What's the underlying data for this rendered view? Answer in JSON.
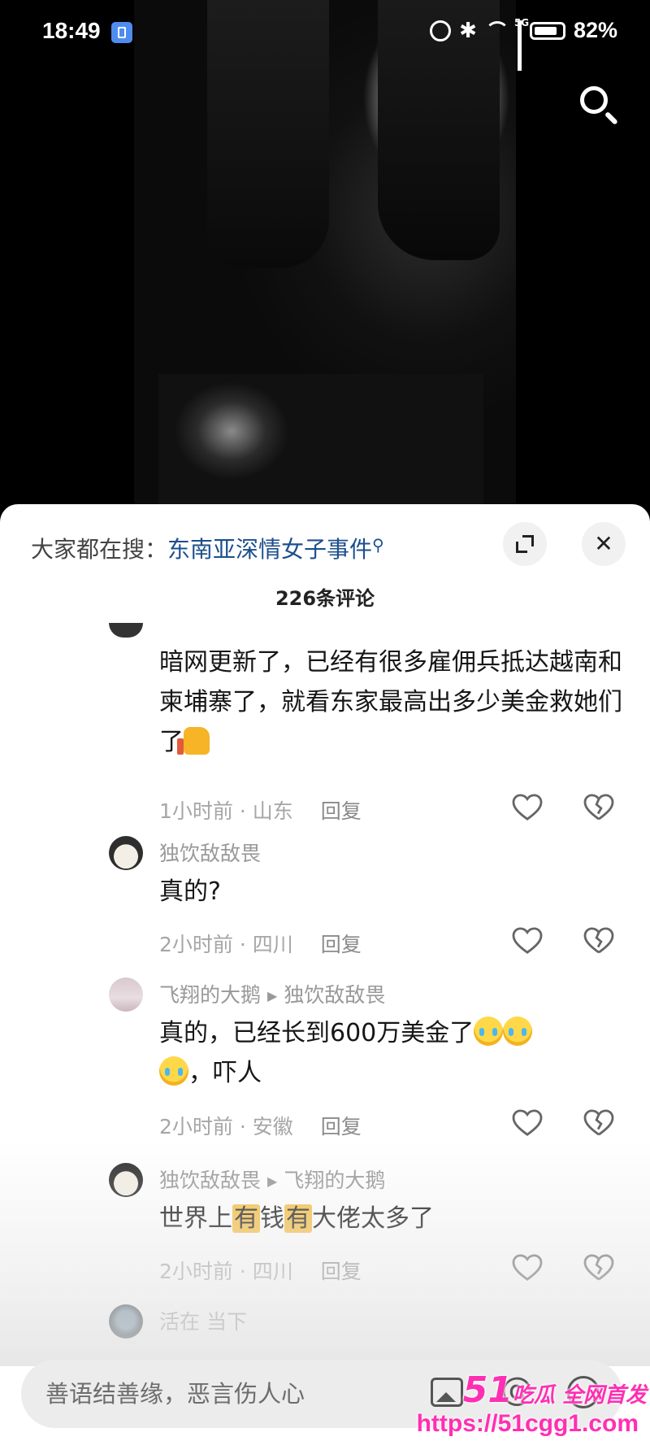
{
  "status_bar": {
    "time": "18:49",
    "battery": "82%",
    "network": "5G"
  },
  "comment_sheet": {
    "hot_prefix": "大家都在搜：",
    "hot_term": "东南亚深情女子事件",
    "count_label": "226条评论",
    "reply_label": "回复",
    "comments": [
      {
        "text": "暗网更新了，已经有很多雇佣兵抵达越南和柬埔寨了，就看东家最高出多少美金救她们了",
        "time": "1小时前 · 山东"
      },
      {
        "user": "独饮敌敌畏",
        "text": "真的?",
        "time": "2小时前 · 四川"
      },
      {
        "user": "飞翔的大鹅",
        "reply_to": "独饮敌敌畏",
        "text_a": "真的，已经长到600万美金了",
        "text_b": "，吓人",
        "time": "2小时前 · 安徽"
      },
      {
        "user": "独饮敌敌畏",
        "reply_to": "飞翔的大鹅",
        "text_1": "世界上",
        "text_2": "有",
        "text_3": "钱",
        "text_4": "有",
        "text_5": "大佬太多了",
        "time": "2小时前 · 四川"
      },
      {
        "user": "活在 当下"
      }
    ]
  },
  "input_bar": {
    "placeholder": "善语结善缘，恶言伤人心"
  },
  "watermark": {
    "brand_big": "51",
    "brand_small": "吃瓜 全网首发",
    "url": "https://51cgg1.com"
  }
}
